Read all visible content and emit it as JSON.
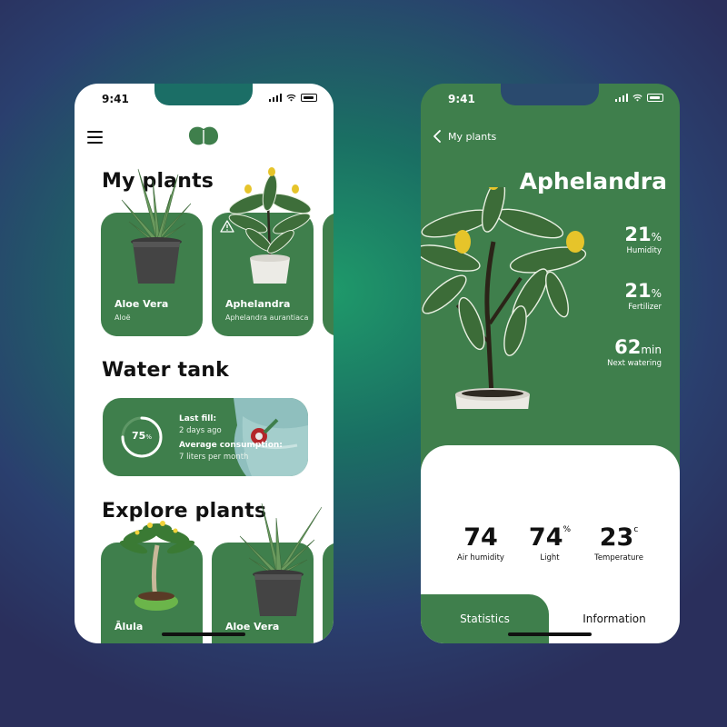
{
  "left_screen": {
    "status": {
      "time": "9:41"
    },
    "my_plants": {
      "title": "My plants",
      "cards": [
        {
          "name": "Aloe Vera",
          "sub": "Aloë",
          "icon": "aloe-plant"
        },
        {
          "name": "Aphelandra",
          "sub": "Aphelandra aurantiaca",
          "icon": "aphelandra-plant",
          "warning": true
        }
      ]
    },
    "water_tank": {
      "title": "Water tank",
      "percent": "75",
      "percent_unit": "%",
      "level": 0.75,
      "last_fill_label": "Last fill:",
      "last_fill_value": "2 days ago",
      "consumption_label": "Average consumption:",
      "consumption_value": "7 liters per month"
    },
    "explore_plants": {
      "title": "Explore plants",
      "cards": [
        {
          "name": "Ālula",
          "icon": "alula-plant"
        },
        {
          "name": "Aloe Vera",
          "icon": "aloe-plant"
        }
      ]
    }
  },
  "right_screen": {
    "status": {
      "time": "9:41"
    },
    "back_label": "My plants",
    "plant_name": "Aphelandra",
    "side_stats": [
      {
        "value": "21",
        "unit": "%",
        "label": "Humidity"
      },
      {
        "value": "21",
        "unit": "%",
        "label": "Fertilizer"
      },
      {
        "value": "62",
        "unit": "min",
        "label": "Next watering"
      }
    ],
    "bottom_stats": [
      {
        "value": "74",
        "unit": "",
        "label": "Air humidity"
      },
      {
        "value": "74",
        "unit": "%",
        "label": "Light"
      },
      {
        "value": "23",
        "unit": "c",
        "label": "Temperature"
      }
    ],
    "tabs": [
      {
        "label": "Statistics",
        "active": true
      },
      {
        "label": "Information",
        "active": false
      }
    ]
  },
  "colors": {
    "brand_green": "#3f7f4c",
    "background_teal": "#1f9a6a",
    "background_indigo": "#2a2f5c"
  }
}
